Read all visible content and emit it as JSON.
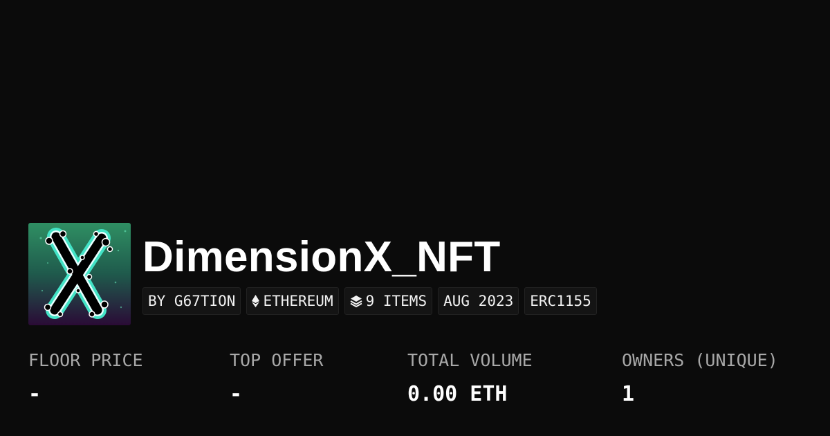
{
  "collection": {
    "name": "DimensionX_NFT",
    "avatar_icon": "x-splatter-logo-icon",
    "colors": {
      "background": "#0b0b0b",
      "avatar_top": "#2f8f63",
      "avatar_bottom": "#2a0b36",
      "avatar_glow": "#43e3c6"
    }
  },
  "badges": {
    "creator": "BY G67TION",
    "chain": "ETHEREUM",
    "chain_icon": "ethereum-icon",
    "items": "9 ITEMS",
    "items_icon": "layers-icon",
    "date": "AUG 2023",
    "standard": "ERC1155"
  },
  "stats": {
    "floor_price": {
      "label": "FLOOR PRICE",
      "value": "-"
    },
    "top_offer": {
      "label": "TOP OFFER",
      "value": "-"
    },
    "total_volume": {
      "label": "TOTAL VOLUME",
      "value": "0.00 ETH"
    },
    "owners": {
      "label": "OWNERS (UNIQUE)",
      "value": "1"
    }
  }
}
